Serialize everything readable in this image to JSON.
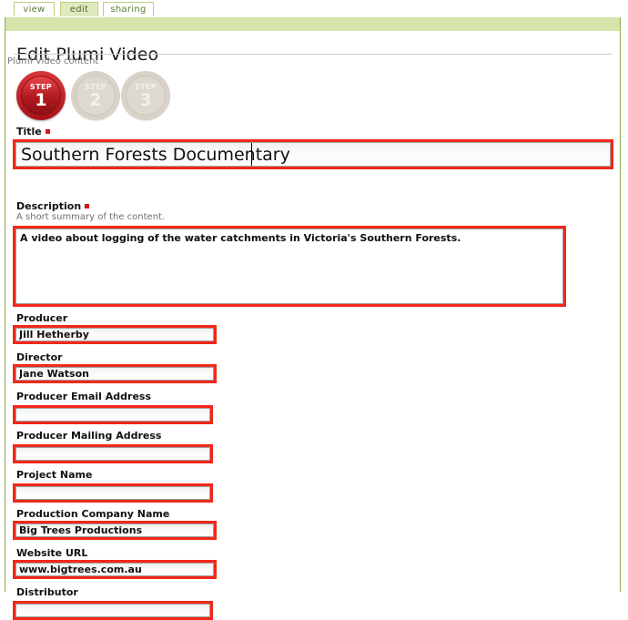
{
  "tabs": [
    {
      "label": "view",
      "active": false
    },
    {
      "label": "edit",
      "active": true
    },
    {
      "label": "sharing",
      "active": false
    }
  ],
  "header": {
    "title": "Edit Plumi Video",
    "content_type": "Plumi Video content"
  },
  "wizard": {
    "steps": [
      {
        "word": "STEP",
        "number": "1",
        "state": "active"
      },
      {
        "word": "STEP",
        "number": "2",
        "state": "idle"
      },
      {
        "word": "STEP",
        "number": "3",
        "state": "idle"
      }
    ]
  },
  "form": {
    "title": {
      "label": "Title",
      "required": true,
      "value": "Southern Forests Documentary",
      "placeholder": ""
    },
    "description": {
      "label": "Description",
      "required": true,
      "hint": "A short summary of the content.",
      "value": "A video about logging of the water catchments in Victoria's Southern Forests.",
      "placeholder": ""
    },
    "producer": {
      "label": "Producer",
      "value": "Jill Hetherby",
      "placeholder": ""
    },
    "director": {
      "label": "Director",
      "value": "Jane Watson",
      "placeholder": ""
    },
    "producer_email": {
      "label": "Producer Email Address",
      "value": "",
      "placeholder": ""
    },
    "producer_mailing": {
      "label": "Producer Mailing Address",
      "value": "",
      "placeholder": ""
    },
    "project_name": {
      "label": "Project Name",
      "value": "",
      "placeholder": ""
    },
    "production_company": {
      "label": "Production Company Name",
      "value": "Big Trees Productions",
      "placeholder": ""
    },
    "website_url": {
      "label": "Website URL",
      "value": "www.bigtrees.com.au",
      "placeholder": ""
    },
    "distributor": {
      "label": "Distributor",
      "value": "",
      "placeholder": ""
    }
  },
  "colors": {
    "highlight": "#f22819",
    "chrome_green": "#8fb04a",
    "band_green": "#d6e3ab",
    "tab_active": "#dfeac0",
    "step_active": "#b01a1f",
    "step_idle": "#ddd8d0",
    "required_marker": "#cf1a1a"
  }
}
